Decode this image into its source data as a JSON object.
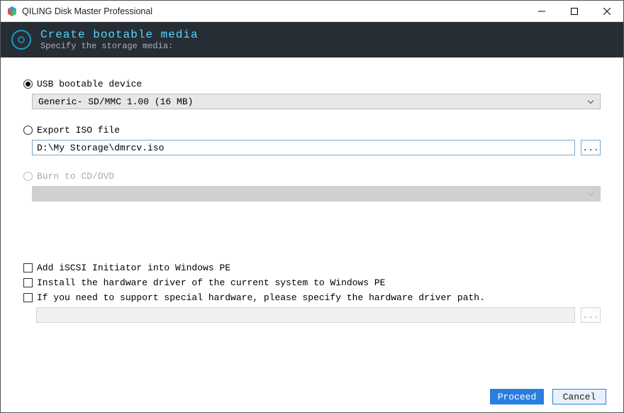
{
  "window": {
    "title": "QILING Disk Master Professional"
  },
  "banner": {
    "title": "Create bootable media",
    "subtitle": "Specify the storage media:"
  },
  "options": {
    "usb": {
      "label": "USB bootable device",
      "selected_device": "Generic- SD/MMC 1.00 (16 MB)"
    },
    "iso": {
      "label": "Export ISO file",
      "path": "D:\\My Storage\\dmrcv.iso"
    },
    "cd": {
      "label": "Burn to CD/DVD"
    }
  },
  "checks": {
    "iscsi": "Add iSCSI Initiator into Windows PE",
    "driver": "Install the hardware driver of the current system to Windows PE",
    "special": "If you need to support special hardware, please specify the hardware driver path."
  },
  "browse_label": "...",
  "footer": {
    "proceed": "Proceed",
    "cancel": "Cancel"
  }
}
